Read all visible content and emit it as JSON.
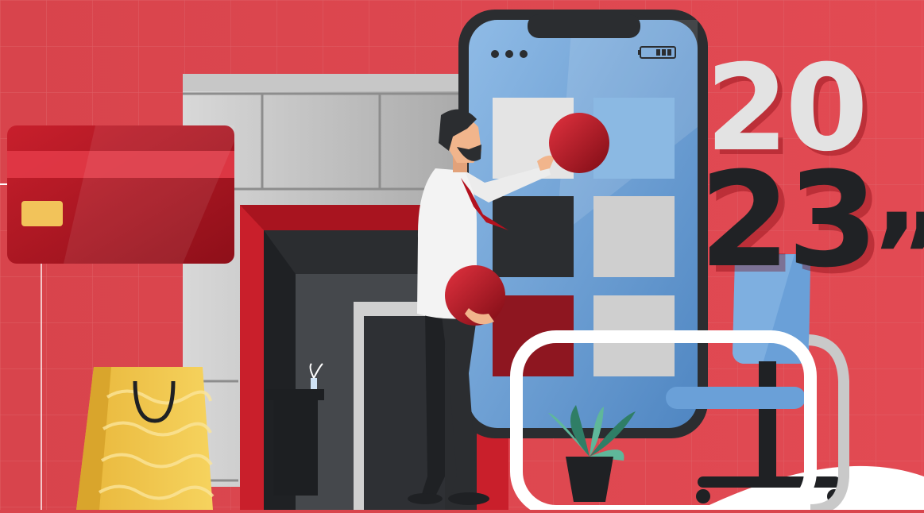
{
  "banner": {
    "year_top": "20",
    "year_bottom": "23",
    "quote_mark": "”"
  },
  "phone": {
    "battery_bars": 3,
    "dots": 3
  },
  "colors": {
    "background": "#d9454d",
    "accent_red": "#b3121f",
    "dark": "#202225",
    "phone_screen": "#6ea2d6",
    "bag_yellow": "#f2c94c",
    "chair_blue": "#6aa0d8"
  },
  "icons": [
    "credit-card-icon",
    "shopping-bag-icon",
    "smartphone-icon",
    "office-chair-icon",
    "potted-plant-icon",
    "shop-building-icon",
    "businessman-figure"
  ]
}
